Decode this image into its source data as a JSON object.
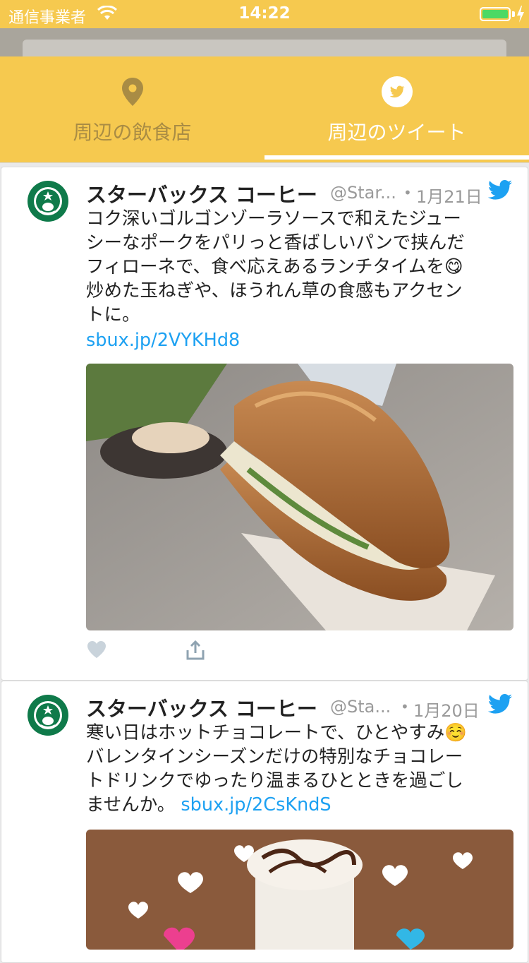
{
  "status_bar": {
    "carrier": "通信事業者",
    "time": "14:22"
  },
  "tabs": [
    {
      "label": "周辺の飲食店",
      "icon": "map-pin-icon",
      "selected": false
    },
    {
      "label": "周辺のツイート",
      "icon": "twitter-icon",
      "selected": true
    }
  ],
  "colors": {
    "accent": "#f6c94f",
    "link": "#1da1f2",
    "inactive_tab": "#a98c44"
  },
  "tweets": [
    {
      "name": "スターバックス コーヒー",
      "handle": "@Star...",
      "date": "1月21日",
      "lines": [
        "コク深いゴルゴンゾーラソースで和えたジュー",
        "シーなポークをパリっと香ばしいパンで挟んだ",
        "フィローネで、食べ応えあるランチタイムを😋",
        "炒めた玉ねぎや、ほうれん草の食感もアクセン",
        "トに。"
      ],
      "link": "sbux.jp/2VYKHd8"
    },
    {
      "name": "スターバックス コーヒー",
      "handle": "@Sta...",
      "date": "1月20日",
      "lines": [
        "寒い日はホットチョコレートで、ひとやすみ☺️",
        "バレンタインシーズンだけの特別なチョコレー",
        "トドリンクでゆったり温まるひとときを過ごし"
      ],
      "last_line_text": "ませんか。",
      "link": "sbux.jp/2CsKndS"
    }
  ]
}
